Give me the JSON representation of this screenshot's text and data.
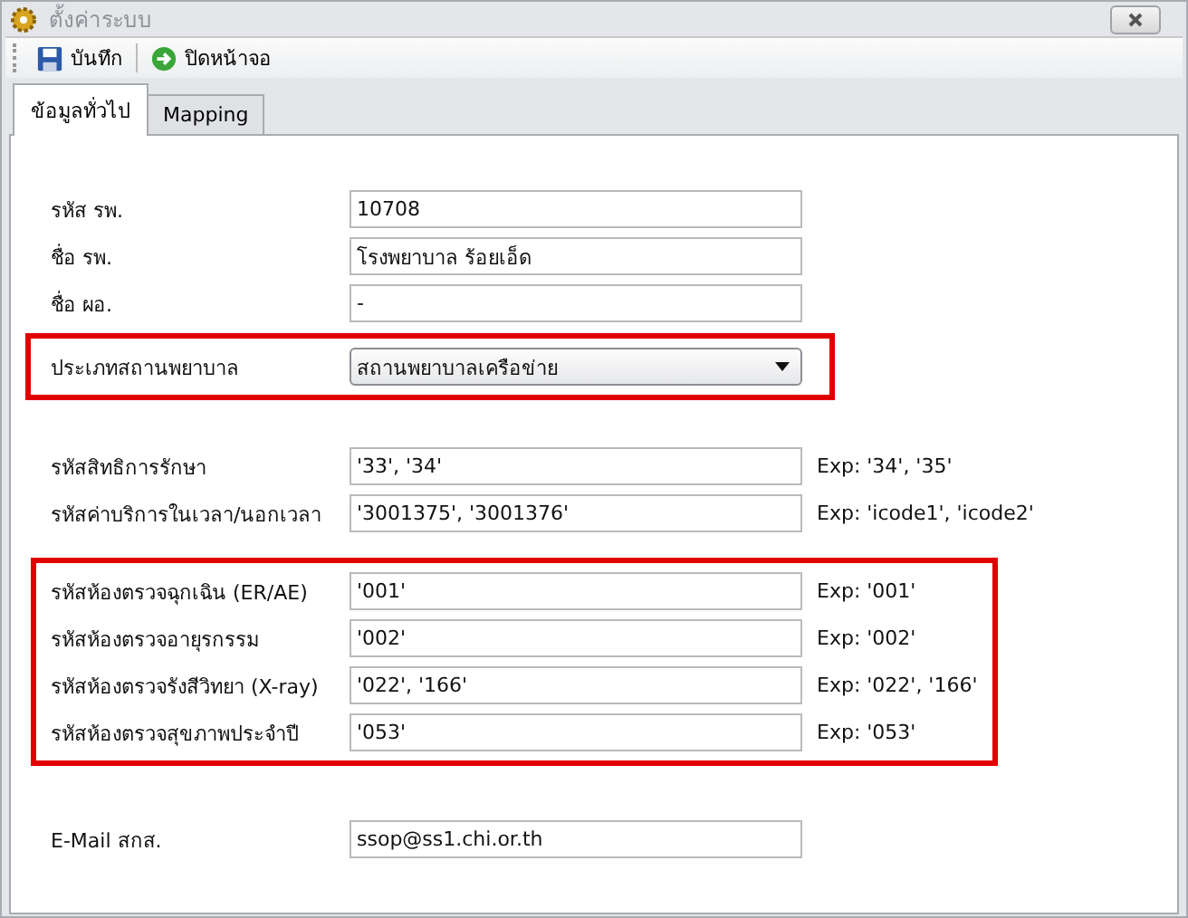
{
  "window": {
    "title": "ตั้งค่าระบบ"
  },
  "toolbar": {
    "buttons": [
      {
        "label": "บันทึก",
        "kind": "save"
      },
      {
        "label": "ปิดหน้าจอ",
        "kind": "close"
      }
    ]
  },
  "tabs": [
    {
      "label": "ข้อมูลทั่วไป",
      "selected": true
    },
    {
      "label": "Mapping",
      "selected": false
    }
  ],
  "sections": [
    {
      "highlighted": false,
      "rows": [
        {
          "label": "รหัส รพ.",
          "kind": "text",
          "value": "10708"
        },
        {
          "label": "ชื่อ รพ.",
          "kind": "text",
          "value": "โรงพยาบาล ร้อยเอ็ด"
        },
        {
          "label": "ชื่อ ผอ.",
          "kind": "text",
          "value": "-"
        }
      ]
    },
    {
      "highlighted": true,
      "rows": [
        {
          "label": "ประเภทสถานพยาบาล",
          "kind": "dropdown",
          "value": "สถานพยาบาลเครือข่าย"
        }
      ]
    },
    {
      "highlighted": false,
      "rows": [
        {
          "label": "รหัสสิทธิการรักษา",
          "kind": "text",
          "value": "'33', '34'",
          "hint": "Exp: '34', '35'"
        },
        {
          "label": "รหัสค่าบริการในเวลา/นอกเวลา",
          "kind": "text",
          "value": "'3001375', '3001376'",
          "hint": "Exp: 'icode1', 'icode2'"
        }
      ]
    },
    {
      "highlighted": true,
      "rows": [
        {
          "label": "รหัสห้องตรวจฉุกเฉิน (ER/AE)",
          "kind": "text",
          "value": "'001'",
          "hint": "Exp: '001'"
        },
        {
          "label": "รหัสห้องตรวจอายุรกรรม",
          "kind": "text",
          "value": "'002'",
          "hint": "Exp: '002'"
        },
        {
          "label": "รหัสห้องตรวจรังสีวิทยา (X-ray)",
          "kind": "text",
          "value": "'022', '166'",
          "hint": "Exp: '022', '166'"
        },
        {
          "label": "รหัสห้องตรวจสุขภาพประจำปี",
          "kind": "text",
          "value": "'053'",
          "hint": "Exp: '053'"
        }
      ]
    },
    {
      "highlighted": false,
      "rows": [
        {
          "label": "E-Mail สกส.",
          "kind": "text",
          "value": "ssop@ss1.chi.or.th"
        }
      ]
    }
  ]
}
